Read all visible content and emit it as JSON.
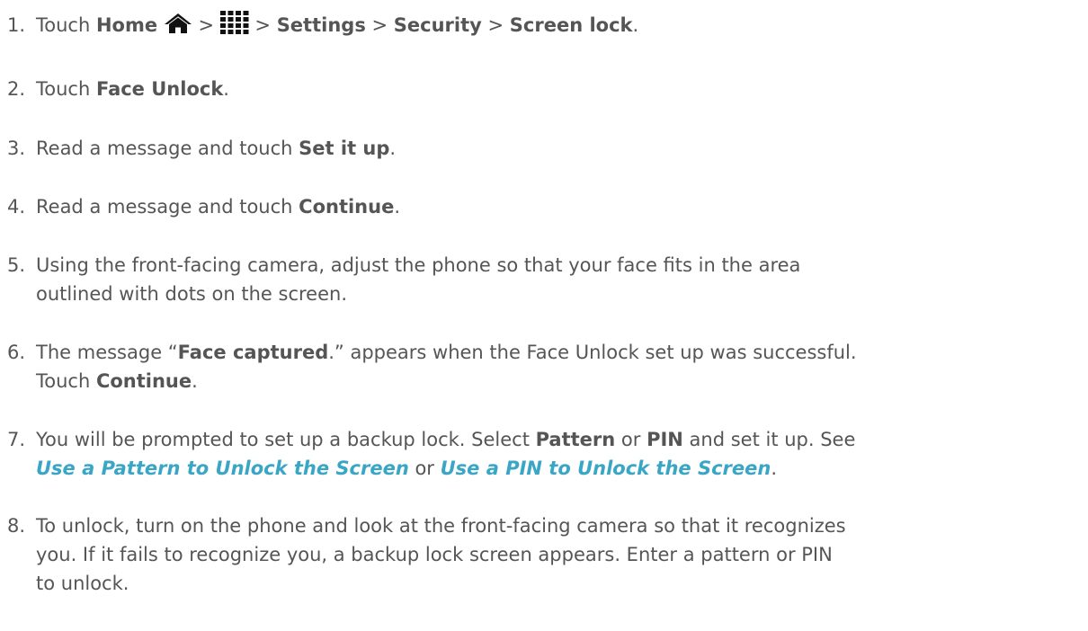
{
  "steps": [
    {
      "num": "1.",
      "parts": {
        "t1": "Touch ",
        "b1": "Home",
        "sep1": " > ",
        "sep2": " > ",
        "b2": "Settings",
        "sep3": " > ",
        "b3": "Security",
        "sep4": " > ",
        "b4": "Screen lock",
        "end": "."
      },
      "icons": [
        "home-icon",
        "apps-grid-icon"
      ]
    },
    {
      "num": "2.",
      "parts": {
        "t1": "Touch ",
        "b1": "Face Unlock",
        "end": "."
      }
    },
    {
      "num": "3.",
      "parts": {
        "t1": "Read a message and touch ",
        "b1": "Set it up",
        "end": "."
      }
    },
    {
      "num": "4.",
      "parts": {
        "t1": "Read a message and touch ",
        "b1": "Continue",
        "end": "."
      }
    },
    {
      "num": "5.",
      "parts": {
        "line1": "Using the front-facing camera, adjust the phone so that your face fits in the area",
        "line2": "outlined with dots on the screen."
      }
    },
    {
      "num": "6.",
      "parts": {
        "t1": "The message “",
        "b1": "Face captured",
        "t2": ".” appears when the Face Unlock set up was successful.",
        "t3": "Touch ",
        "b2": "Continue",
        "end": "."
      }
    },
    {
      "num": "7.",
      "parts": {
        "t1": "You will be prompted to set up a backup lock. Select ",
        "b1": "Pattern",
        "t2": " or ",
        "b2": "PIN",
        "t3": " and set it up. See",
        "l1": "Use a Pattern to Unlock the Screen",
        "t4": " or ",
        "l2": "Use a PIN to Unlock the Screen",
        "end": "."
      }
    },
    {
      "num": "8.",
      "parts": {
        "line1": "To unlock, turn on the phone and look at the front-facing camera so that it recognizes",
        "line2": "you. If it fails to recognize you, a backup lock screen appears. Enter a pattern or PIN",
        "line3": "to unlock."
      }
    }
  ],
  "colors": {
    "text": "#555555",
    "link": "#3aa6c6"
  }
}
